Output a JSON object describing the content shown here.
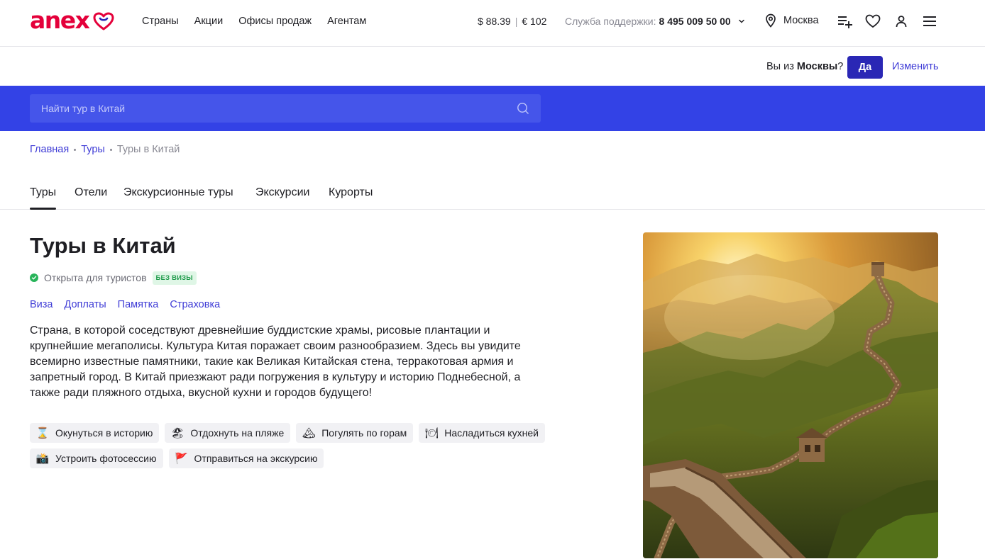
{
  "header": {
    "logo_text": "anex",
    "nav": [
      "Страны",
      "Акции",
      "Офисы продаж",
      "Агентам"
    ],
    "currency": {
      "usd": "$ 88.39",
      "sep": "|",
      "eur": "€ 102"
    },
    "support": {
      "label": "Служба поддержки:",
      "phone": "8 495 009 50 00"
    },
    "city": "Москва",
    "icons": [
      "playlist-add-icon",
      "heart-icon",
      "user-icon",
      "menu-icon"
    ]
  },
  "geo": {
    "question_prefix": "Вы из ",
    "question_city": "Москвы",
    "question_suffix": "?",
    "yes": "Да",
    "change": "Изменить"
  },
  "search": {
    "placeholder": "Найти тур в Китай"
  },
  "breadcrumb": [
    "Главная",
    "Туры",
    "Туры в Китай"
  ],
  "tabs": [
    "Туры",
    "Отели",
    "Экскурсионные туры",
    "Экскурсии",
    "Курорты"
  ],
  "main": {
    "title": "Туры в Китай",
    "status": "Открыта для туристов",
    "badge": "БЕЗ ВИЗЫ",
    "links": [
      "Виза",
      "Доплаты",
      "Памятка",
      "Страховка"
    ],
    "description": "Страна, в которой соседствуют древнейшие буддистские храмы, рисовые плантации и крупнейшие мегаполисы. Культура Китая поражает своим разнообразием. Здесь вы увидите всемирно известные памятники, такие как Великая Китайская стена, терракотовая армия и запретный город. В Китай приезжают ради погружения в культуру и историю Поднебесной, а также ради пляжного отдыха, вкусной кухни и городов будущего!",
    "chips": [
      {
        "icon": "⌛",
        "label": "Окунуться в историю"
      },
      {
        "icon": "🏖",
        "label": "Отдохнуть на пляже"
      },
      {
        "icon": "🏔",
        "label": "Погулять по горам"
      },
      {
        "icon": "🍽",
        "label": "Насладиться кухней"
      },
      {
        "icon": "📸",
        "label": "Устроить фотосессию"
      },
      {
        "icon": "🚩",
        "label": "Отправиться на экскурсию"
      }
    ]
  },
  "colors": {
    "brand_red": "#e4003a",
    "accent_blue": "#3342e6",
    "link": "#3f3cd6",
    "button": "#2a27b5"
  }
}
